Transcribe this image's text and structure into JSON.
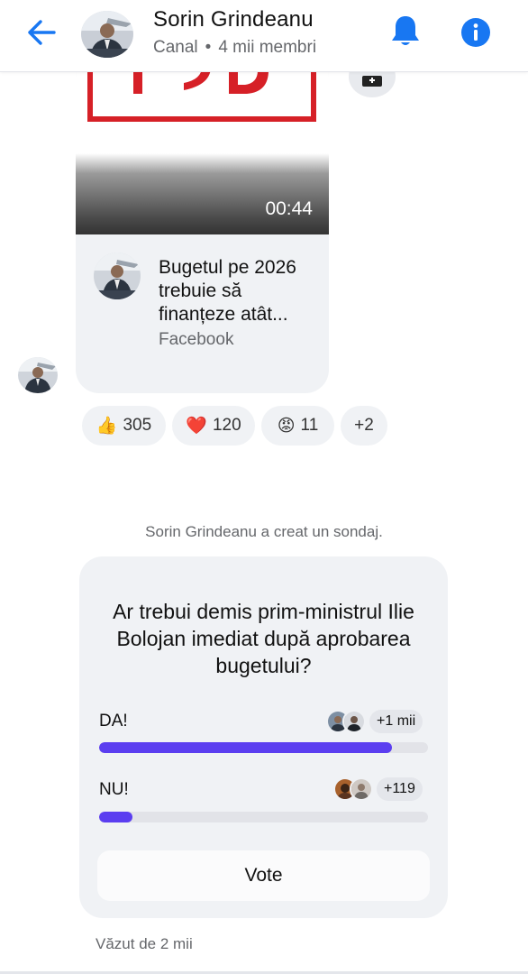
{
  "header": {
    "back_icon": "arrow-left-icon",
    "title": "Sorin Grindeanu",
    "subtitle_type": "Canal",
    "subtitle_separator": "•",
    "subtitle_members": "4 mii membri",
    "bell_icon": "bell-icon",
    "info_icon": "info-icon",
    "accent_color": "#1877f2"
  },
  "post": {
    "video_duration": "00:44",
    "thumbnail_text": "PSD",
    "link_title": "Bugetul pe 2026 trebuie să finanțeze atât...",
    "link_source": "Facebook",
    "share_icon": "share-icon"
  },
  "reactions": [
    {
      "emoji": "👍",
      "count": "305"
    },
    {
      "emoji": "❤️",
      "count": "120"
    },
    {
      "emoji": "😡",
      "count": "11"
    },
    {
      "emoji": "",
      "count": "+2"
    }
  ],
  "system_message": "Sorin Grindeanu a creat un sondaj.",
  "poll": {
    "question": "Ar trebui demis prim-ministrul Ilie Bolojan imediat după aprobarea bugetului?",
    "options": [
      {
        "label": "DA!",
        "votes_label": "+1 mii",
        "fill": 0.89
      },
      {
        "label": "NU!",
        "votes_label": "+119",
        "fill": 0.1
      }
    ],
    "vote_button": "Vote",
    "bar_color": "#5b3ef0"
  },
  "seen_by": "Văzut de 2 mii"
}
